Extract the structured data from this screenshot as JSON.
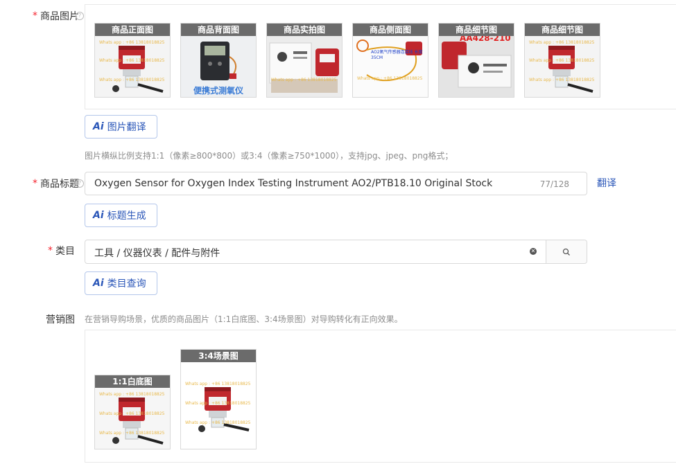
{
  "product_images": {
    "label": "商品图片",
    "required_mark": "*",
    "cards": [
      {
        "caption": "商品正面图",
        "thumb": "sensor-front"
      },
      {
        "caption": "商品背面图",
        "thumb": "portable-meter",
        "overlay_text": "便携式测氧仪"
      },
      {
        "caption": "商品实拍图",
        "thumb": "packaging"
      },
      {
        "caption": "商品侧面图",
        "thumb": "cable-side",
        "overlay_text": "AO2氧气传感器连接线 长度35CM"
      },
      {
        "caption": "商品细节图",
        "thumb": "detail-label",
        "overlay_text": "AA428-210"
      },
      {
        "caption": "商品细节图",
        "thumb": "sensor-detail"
      }
    ],
    "translate_button": {
      "ai": "Ai",
      "label": "图片翻译"
    },
    "hint": "图片横纵比例支持1:1（像素≥800*800）或3:4（像素≥750*1000），支持jpg、jpeg、png格式；"
  },
  "title_field": {
    "label": "商品标题",
    "required_mark": "*",
    "value": "Oxygen Sensor for Oxygen Index Testing Instrument AO2/PTB18.10 Original Stock",
    "counter": "77/128",
    "translate_link": "翻译",
    "generate_button": {
      "ai": "Ai",
      "label": "标题生成"
    }
  },
  "category_field": {
    "label": "类目",
    "required_mark": "*",
    "value": "工具 / 仪器仪表 / 配件与附件",
    "query_button": {
      "ai": "Ai",
      "label": "类目查询"
    }
  },
  "marketing": {
    "label": "营销图",
    "hint": "在营销导购场景，优质的商品图片（1:1白底图、3:4场景图）对导购转化有正向效果。",
    "cards": [
      {
        "caption": "1:1白底图"
      },
      {
        "caption": "3:4场景图"
      }
    ]
  },
  "watermark_text": "Whats app : +86 13818018825",
  "colors": {
    "accent": "#2a56b8",
    "required": "#f5222d",
    "caption_bg": "#6b6b6b"
  }
}
